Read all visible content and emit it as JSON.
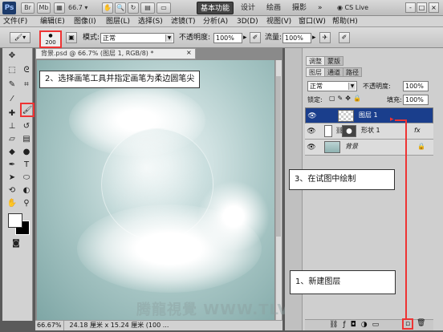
{
  "app": {
    "logo": "Ps",
    "btn_br": "Br",
    "btn_mb": "Mb",
    "zoom": "66.7",
    "workspaces": [
      "基本功能",
      "设计",
      "绘画",
      "摄影"
    ],
    "more": "»",
    "cslive": "CS Live",
    "win_controls": [
      "-",
      "□",
      "×"
    ]
  },
  "menus": [
    "文件(F)",
    "编辑(E)",
    "图像(I)",
    "图层(L)",
    "选择(S)",
    "滤镜(T)",
    "分析(A)",
    "3D(D)",
    "视图(V)",
    "窗口(W)",
    "帮助(H)"
  ],
  "options": {
    "brush_size": "200",
    "mode_label": "模式:",
    "mode_value": "正常",
    "opacity_label": "不透明度:",
    "opacity_value": "100%",
    "flow_label": "流量:",
    "flow_value": "100%"
  },
  "document": {
    "tab": "背景.psd @ 66.7% (图层 1, RGB/8) *",
    "zoom_status": "66.67%",
    "size_status": "24.18 厘米 x 15.24 厘米 (100 ..."
  },
  "panels": {
    "top_tabs": [
      "调整",
      "蒙版"
    ],
    "layer_tabs": [
      "图层",
      "通道",
      "路径"
    ],
    "blend_mode": "正常",
    "opacity_label": "不透明度:",
    "opacity_value": "100%",
    "lock_label": "锁定:",
    "fill_label": "填充:",
    "fill_value": "100%",
    "layers": [
      {
        "name": "图层 1",
        "selected": true
      },
      {
        "name": "形状 1",
        "selected": false
      },
      {
        "name": "背景",
        "selected": false
      }
    ],
    "fx": "fx"
  },
  "annotations": {
    "step2": "2、选择画笔工具并指定画笔为柔边圆笔尖",
    "step3": "3、在试图中绘制",
    "step1": "1、新建图层"
  },
  "watermark": "腾龍視覺 WWW.TLVI.NET",
  "colors": {
    "accent_red": "#e33333",
    "selected_layer": "#1a3e8c",
    "canvas_teal": "#a9c7c6"
  }
}
